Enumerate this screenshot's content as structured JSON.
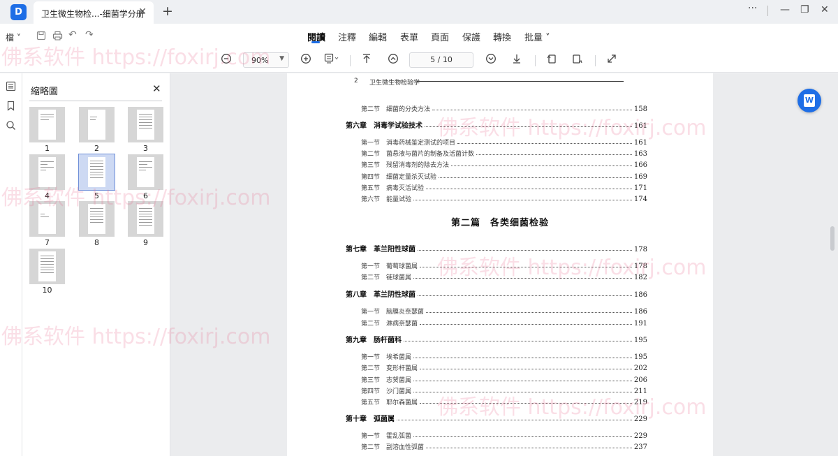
{
  "titlebar": {
    "logo_glyph": "D",
    "tab_title": "卫生微生物检...-细菌学分册",
    "tab_close": "✕",
    "new_tab": "+",
    "more": "···",
    "minimize": "—",
    "restore": "❐",
    "close": "✕"
  },
  "menubar": {
    "file_label": "檔 ˅",
    "items": [
      "閱讀",
      "注釋",
      "編輯",
      "表單",
      "頁面",
      "保護",
      "轉換",
      "批量 ˅"
    ],
    "active_index": 0
  },
  "toolbar": {
    "zoom_value": "90%",
    "page_indicator": "5 / 10"
  },
  "thumbnails": {
    "title": "縮略圖",
    "close": "✕",
    "pages": [
      "1",
      "2",
      "3",
      "4",
      "5",
      "6",
      "7",
      "8",
      "9",
      "10"
    ],
    "selected_index": 4
  },
  "page": {
    "header_num": "2",
    "header_title": "卫生微生物检验学",
    "part_title": "第二篇　各类细菌检验",
    "rows": [
      {
        "kind": "sub",
        "label": "第二节　细菌的分类方法",
        "page": "158"
      },
      {
        "kind": "chap",
        "label": "第六章　消毒学试验技术",
        "page": "161"
      },
      {
        "kind": "sub",
        "label": "第一节　消毒药械鉴定测试的项目",
        "page": "161"
      },
      {
        "kind": "sub",
        "label": "第二节　菌悬液与菌片的制备及活菌计数",
        "page": "163"
      },
      {
        "kind": "sub",
        "label": "第三节　残留消毒剂的除去方法",
        "page": "166"
      },
      {
        "kind": "sub",
        "label": "第四节　细菌定量杀灭试验",
        "page": "169"
      },
      {
        "kind": "sub",
        "label": "第五节　病毒灭活试验",
        "page": "171"
      },
      {
        "kind": "sub",
        "label": "第六节　能量试验",
        "page": "174"
      },
      {
        "kind": "chap",
        "label": "第七章　革兰阳性球菌",
        "page": "178"
      },
      {
        "kind": "sub",
        "label": "第一节　葡萄球菌属",
        "page": "178"
      },
      {
        "kind": "sub",
        "label": "第二节　链球菌属",
        "page": "182"
      },
      {
        "kind": "chap",
        "label": "第八章　革兰阴性球菌",
        "page": "186"
      },
      {
        "kind": "sub",
        "label": "第一节　脑膜炎奈瑟菌",
        "page": "186"
      },
      {
        "kind": "sub",
        "label": "第二节　淋病奈瑟菌",
        "page": "191"
      },
      {
        "kind": "chap",
        "label": "第九章　肠杆菌科",
        "page": "195"
      },
      {
        "kind": "sub",
        "label": "第一节　埃希菌属",
        "page": "195"
      },
      {
        "kind": "sub",
        "label": "第二节　变形杆菌属",
        "page": "202"
      },
      {
        "kind": "sub",
        "label": "第三节　志贺菌属",
        "page": "206"
      },
      {
        "kind": "sub",
        "label": "第四节　沙门菌属",
        "page": "211"
      },
      {
        "kind": "sub",
        "label": "第五节　耶尔森菌属",
        "page": "219"
      },
      {
        "kind": "chap",
        "label": "第十章　弧菌属",
        "page": "229"
      },
      {
        "kind": "sub",
        "label": "第一节　霍乱弧菌",
        "page": "229"
      },
      {
        "kind": "sub",
        "label": "第二节　副溶血性弧菌",
        "page": "237"
      }
    ]
  },
  "float": {
    "word_glyph": "W"
  },
  "watermark": {
    "text": "佛系软件 https://foxirj.com"
  },
  "colors": {
    "accent": "#1e6ee6",
    "watermark": "#e8698c"
  }
}
